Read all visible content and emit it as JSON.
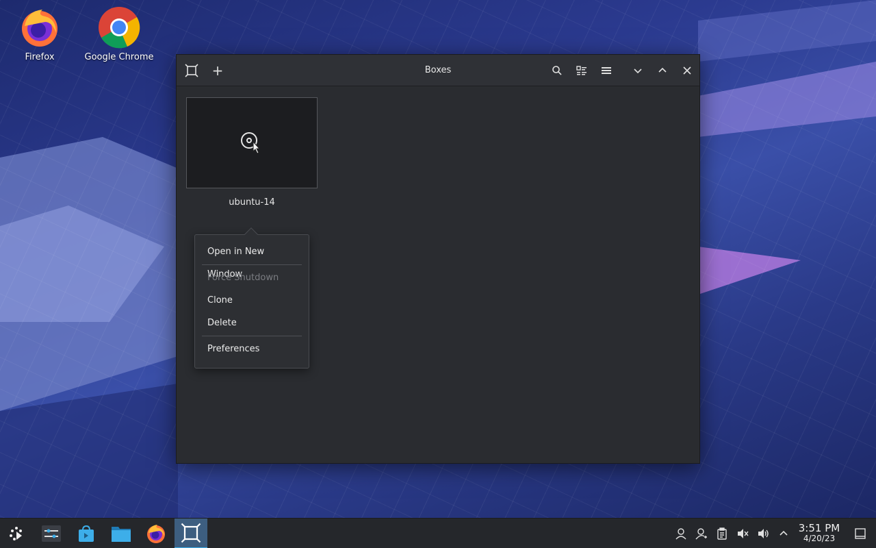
{
  "desktop": {
    "icons": [
      {
        "label": "Firefox",
        "icon": "firefox-icon"
      },
      {
        "label": "Google Chrome",
        "icon": "chrome-icon"
      }
    ]
  },
  "window": {
    "title": "Boxes",
    "toolbar": {
      "app_icon": "boxes-icon",
      "new_icon": "plus-icon",
      "search_icon": "search-icon",
      "view_icon": "view-toggle-icon",
      "menu_icon": "hamburger-icon",
      "minimize_icon": "chevron-down-icon",
      "maximize_icon": "chevron-up-icon",
      "close_icon": "close-icon"
    },
    "vm": {
      "name": "ubuntu-14",
      "icon": "disc-icon"
    },
    "context_menu": {
      "items": [
        {
          "label": "Open in New Window",
          "enabled": true
        },
        {
          "label": "Force Shutdown",
          "enabled": false
        },
        {
          "label": "Clone",
          "enabled": true
        },
        {
          "label": "Delete",
          "enabled": true
        },
        {
          "label": "Preferences",
          "enabled": true
        }
      ]
    }
  },
  "taskbar": {
    "clock": {
      "time": "3:51 PM",
      "date": "4/20/23"
    },
    "colors": {
      "active_task": "#3d5e80",
      "accent": "#3daee9"
    }
  }
}
